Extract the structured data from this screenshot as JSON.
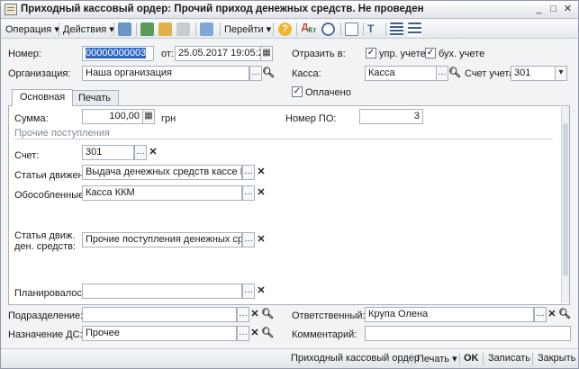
{
  "window": {
    "title": "Приходный кассовый ордер: Прочий приход денежных средств. Не проведен"
  },
  "toolbar": {
    "operation": "Операция ▾",
    "actions": "Действия ▾",
    "goto": "Перейти ▾"
  },
  "header": {
    "number_label": "Номер:",
    "number_value": "00000000003",
    "from_label": "от:",
    "date_value": "25.05.2017 19:05:24",
    "reflect_label": "Отразить в:",
    "mgmt_label": "упр. учете",
    "acct_label": "бух. учете",
    "org_label": "Организация:",
    "org_value": "Наша организация",
    "cash_label": "Касса:",
    "cash_value": "Касса",
    "account_label": "Счет учета:",
    "account_value": "301",
    "paid_label": "Оплачено"
  },
  "tabs": [
    {
      "label": "Основная"
    },
    {
      "label": "Печать"
    }
  ],
  "main": {
    "sum_label": "Сумма:",
    "sum_value": "100,00",
    "currency": "грн",
    "po_label": "Номер ПО:",
    "po_value": "3",
    "section_title": "Прочие поступления",
    "account_label": "Счет:",
    "account_value": "301",
    "movement_label": "Статьи движен...",
    "movement_value": "Выдача денежных средств кассе ККМ",
    "separate_label": "Обособленные...",
    "separate_value": "Касса ККМ",
    "cashflow_label_1": "Статья движ.",
    "cashflow_label_2": "ден. средств:",
    "cashflow_value": "Прочие поступления денежных средств",
    "planned_label": "Планировалось",
    "planned_value": ""
  },
  "footer_fields": {
    "division_label": "Подразделение:",
    "division_value": "",
    "responsible_label": "Ответственный:",
    "responsible_value": "Крупа Олена",
    "purpose_label": "Назначение ДС:",
    "purpose_value": "Прочее",
    "comment_label": "Комментарий:",
    "comment_value": ""
  },
  "bottom": {
    "print_form": "Приходный кассовый ордер",
    "print": "Печать ▾",
    "ok": "OK",
    "save": "Записать",
    "close": "Закрыть"
  },
  "colors": {
    "selection": "#316ac5",
    "panel_border": "#a9b3bf"
  }
}
